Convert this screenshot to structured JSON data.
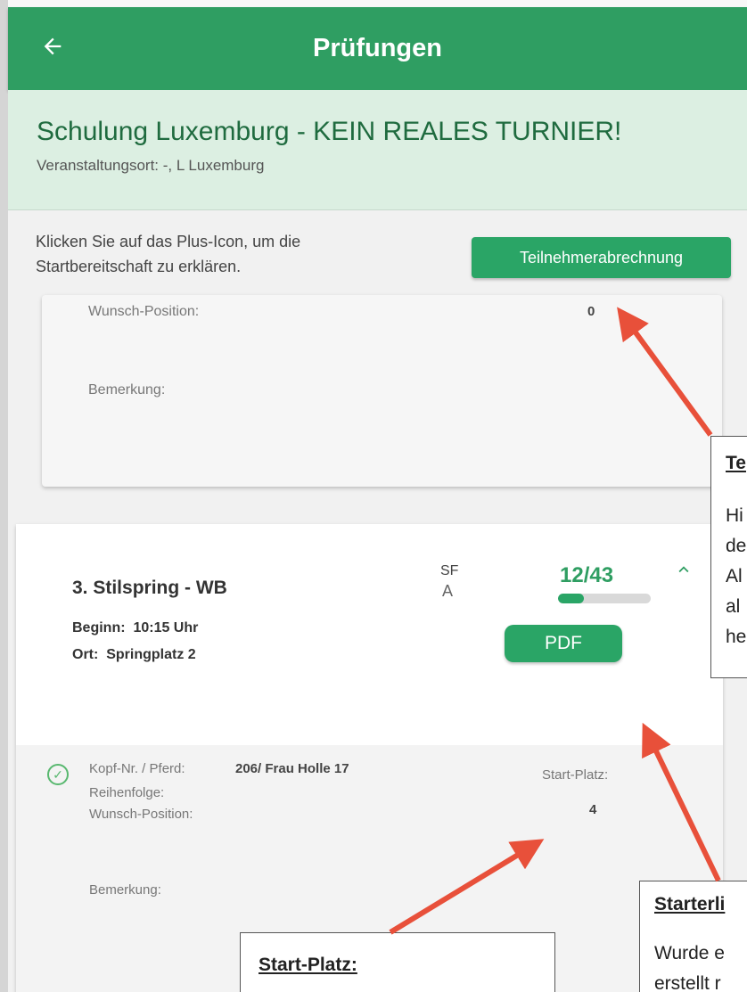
{
  "appbar": {
    "title": "Prüfungen",
    "back_icon": "arrow-left-icon"
  },
  "event": {
    "title": "Schulung Luxemburg - KEIN REALES TURNIER!",
    "venue": "Veranstaltungsort: -, L Luxemburg"
  },
  "hint": "Klicken Sie auf das Plus-Icon, um die Startbereitschaft zu erklären.",
  "settlement_button": "Teilnehmerabrechnung",
  "prev_card": {
    "wish_position_label": "Wunsch-Position:",
    "wish_position_value": "0",
    "remark_label": "Bemerkung:"
  },
  "competition": {
    "title": "3. Stilspring - WB",
    "code_top": "SF",
    "code_bottom": "A",
    "count": "12/43",
    "progress_fraction": 0.279,
    "start_label": "Beginn:",
    "start_value": "10:15 Uhr",
    "place_label": "Ort:",
    "place_value": "Springplatz 2",
    "pdf_button": "PDF"
  },
  "entry": {
    "head_horse_label": "Kopf-Nr. / Pferd:",
    "head_horse_value": "206/ Frau Holle 17",
    "start_place_label": "Start-Platz:",
    "start_place_value": "4",
    "order_label": "Reihenfolge:",
    "wish_position_label": "Wunsch-Position:",
    "remark_label": "Bemerkung:"
  },
  "callouts": {
    "settlement": {
      "head": "Te",
      "lines": [
        "Hi",
        "de",
        "Al",
        "al",
        "he"
      ]
    },
    "starterlist": {
      "head": "Starterli",
      "lines": [
        "Wurde e",
        "erstellt r"
      ]
    },
    "startplace": {
      "head": "Start-Platz:"
    }
  },
  "colors": {
    "primary": "#2f9e62",
    "button": "#2aa566",
    "arrow": "#e8503a"
  }
}
